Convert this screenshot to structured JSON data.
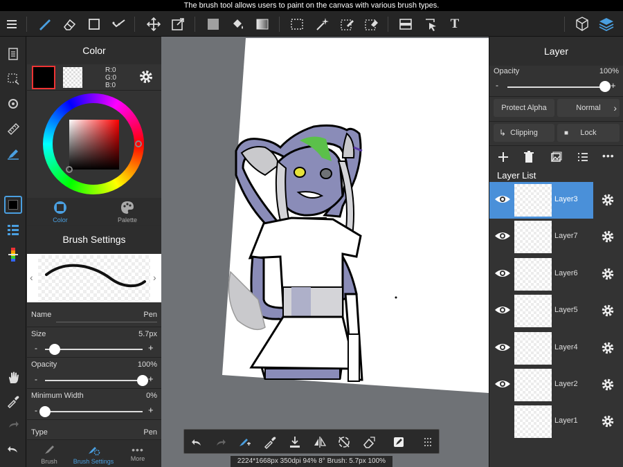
{
  "tooltip": "The brush tool allows users to paint on the canvas with various brush types.",
  "color_panel": {
    "title": "Color",
    "rgb": {
      "r": "R:0",
      "g": "G:0",
      "b": "B:0"
    },
    "tabs": [
      "Color",
      "Palette"
    ]
  },
  "brush_settings": {
    "title": "Brush Settings",
    "name_label": "Name",
    "name_value": "Pen",
    "size_label": "Size",
    "size_value": "5.7px",
    "opacity_label": "Opacity",
    "opacity_value": "100%",
    "minwidth_label": "Minimum Width",
    "minwidth_value": "0%",
    "type_label": "Type",
    "type_value": "Pen",
    "size_fraction": 0.1,
    "opacity_fraction": 1.0,
    "minwidth_fraction": 0.0,
    "tabs": [
      "Brush",
      "Brush Settings",
      "More"
    ]
  },
  "layer_panel": {
    "title": "Layer",
    "opacity_label": "Opacity",
    "opacity_value": "100%",
    "opacity_fraction": 1.0,
    "protect_alpha": "Protect Alpha",
    "blend_mode": "Normal",
    "clipping": "Clipping",
    "lock": "Lock",
    "list_title": "Layer List",
    "layers": [
      {
        "name": "Layer3",
        "visible": true,
        "selected": true
      },
      {
        "name": "Layer7",
        "visible": true,
        "selected": false
      },
      {
        "name": "Layer6",
        "visible": true,
        "selected": false
      },
      {
        "name": "Layer5",
        "visible": true,
        "selected": false
      },
      {
        "name": "Layer4",
        "visible": true,
        "selected": false
      },
      {
        "name": "Layer2",
        "visible": true,
        "selected": false
      },
      {
        "name": "Layer1",
        "visible": false,
        "selected": false
      }
    ]
  },
  "status": "2224*1668px 350dpi 94% 8° Brush: 5.7px 100%",
  "colors": {
    "accent": "#4a9fe0",
    "selected_layer": "#4a90d9",
    "primary_color": "#000000"
  },
  "icons": {
    "topbar": [
      "menu-icon",
      "brush-icon",
      "eraser-icon",
      "rectangle-icon",
      "correction-icon",
      "move-icon",
      "transform-icon",
      "fill-color-icon",
      "bucket-icon",
      "gradient-icon",
      "select-rect-icon",
      "magic-wand-icon",
      "select-pen-icon",
      "select-eraser-icon",
      "layer-panel-icon",
      "select-layer-icon",
      "text-icon",
      "3d-icon",
      "layers-icon"
    ]
  }
}
